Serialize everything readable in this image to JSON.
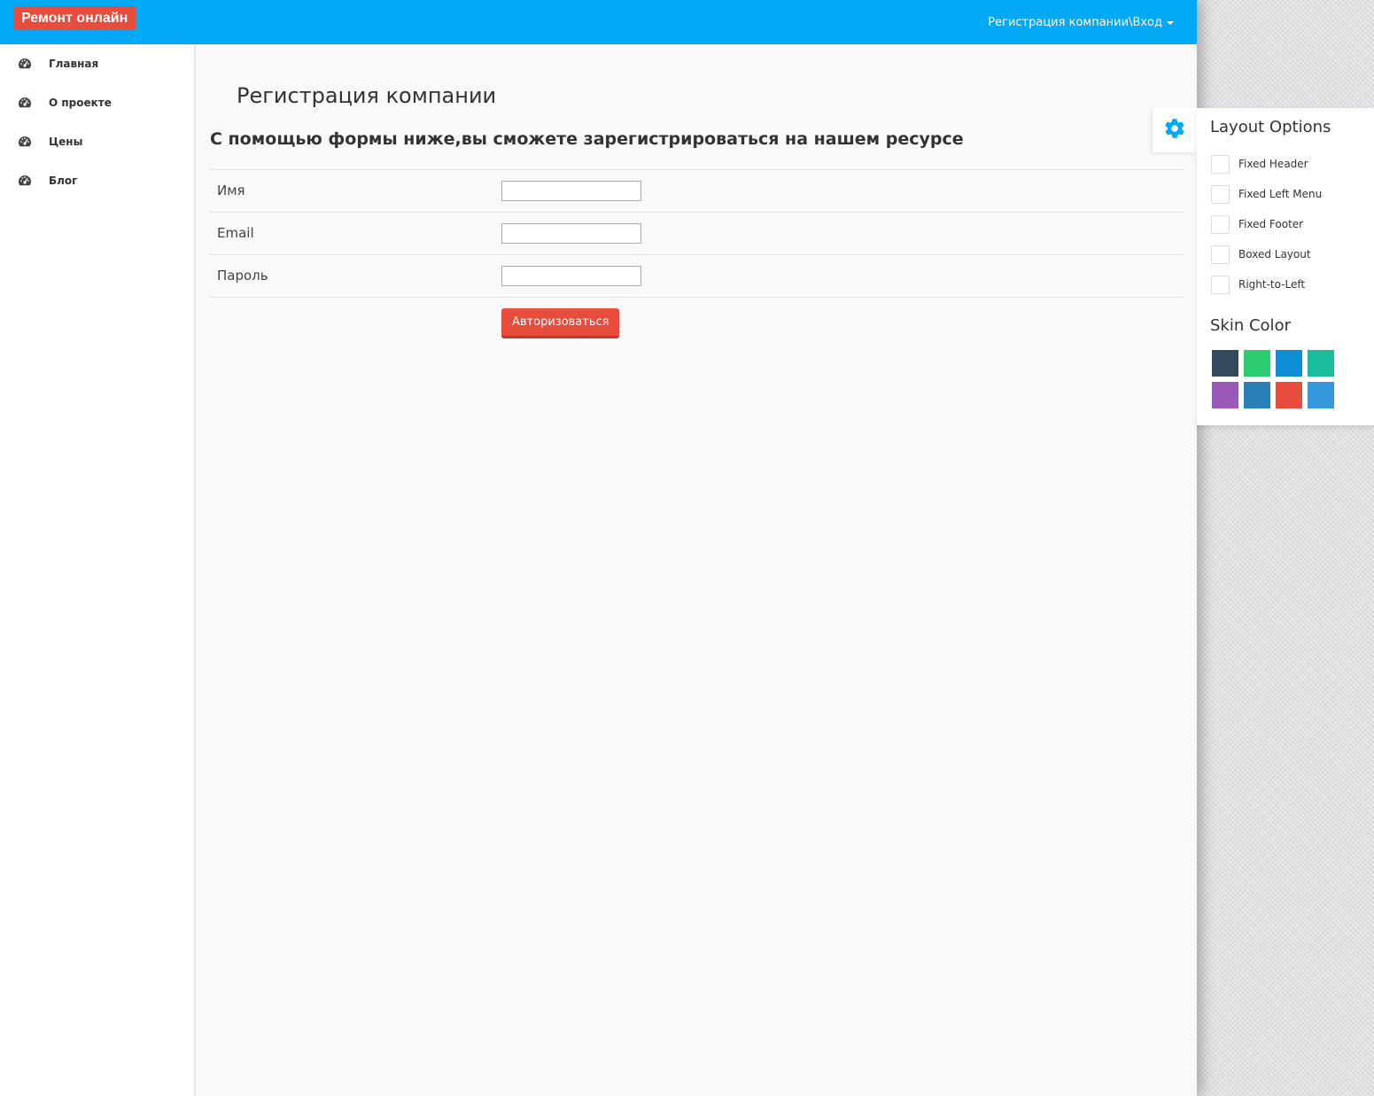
{
  "header": {
    "brand": "Ремонт онлайн",
    "user_menu": "Регистрация компании\\Вход",
    "accent_color": "#03a9f4"
  },
  "sidebar": {
    "items": [
      {
        "label": "Главная",
        "icon": "dashboard-icon"
      },
      {
        "label": "О проекте",
        "icon": "dashboard-icon"
      },
      {
        "label": "Цены",
        "icon": "dashboard-icon"
      },
      {
        "label": "Блог",
        "icon": "dashboard-icon"
      }
    ]
  },
  "main": {
    "title": "Регистрация компании",
    "subtitle": "С помощью формы ниже,вы сможете зарегистрироваться на нашем ресурсе",
    "fields": [
      {
        "label": "Имя",
        "value": ""
      },
      {
        "label": "Email",
        "value": ""
      },
      {
        "label": "Пароль",
        "value": ""
      }
    ],
    "submit_label": "Авторизоваться",
    "submit_color": "#e74c3c"
  },
  "layout_options": {
    "title": "Layout Options",
    "options": [
      {
        "label": "Fixed Header",
        "checked": false
      },
      {
        "label": "Fixed Left Menu",
        "checked": false
      },
      {
        "label": "Fixed Footer",
        "checked": false
      },
      {
        "label": "Boxed Layout",
        "checked": false
      },
      {
        "label": "Right-to-Left",
        "checked": false
      }
    ],
    "skin_title": "Skin Color",
    "skin_colors": [
      "#34495e",
      "#2ecc71",
      "#0f8ed6",
      "#1abc9c",
      "#9b59b6",
      "#2980b9",
      "#e74c3c",
      "#3498db"
    ],
    "toggle_icon": "gear-icon"
  }
}
